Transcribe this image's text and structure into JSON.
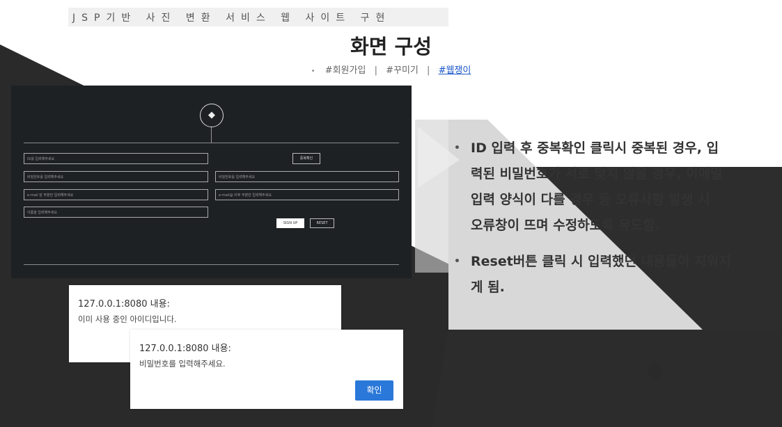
{
  "header": {
    "section_title": "JSP기반 사진 변환 서비스 웹 사이트 구현",
    "slide_title": "화면 구성",
    "tags": [
      "#회원가입",
      "#꾸미기",
      "#웹쟁이"
    ],
    "active_tag": "#웹쟁이"
  },
  "signup_form": {
    "fields": {
      "id": "ID를 입력해주세요",
      "password": "비밀번호를 입력해주세요",
      "password_confirm": "비밀번호를 입력해주세요",
      "email_local": "e-mail 앞 부분만 입력해주세요",
      "email_domain": "e-mail@ 이후 부분만 입력해주세요.",
      "name": "이름을 입력해주세요"
    },
    "buttons": {
      "check_duplicate": "중복확인",
      "sign_up": "SIGN UP",
      "reset": "RESET"
    }
  },
  "dialogs": [
    {
      "title": "127.0.0.1:8080 내용:",
      "message": "이미 사용 중인 아이디입니다."
    },
    {
      "title": "127.0.0.1:8080 내용:",
      "message": "비밀번호를 입력해주세요.",
      "confirm_label": "확인"
    }
  ],
  "bullets": [
    {
      "lines": [
        "ID 입력 후 중복확인 클릭시 중복된 경우, 입",
        "력된 비밀번호가 서로 맞지 않을 경우, 이메일",
        "입력 양식이 다를 경우 등 오류사항 발생 시",
        "오류창이 뜨며 수정하도록 유도함."
      ]
    },
    {
      "lines": [
        "Reset버튼 클릭 시 입력했던 내용들이 지워지",
        "게 됨."
      ]
    }
  ],
  "colors": {
    "accent_blue": "#2a78d9",
    "link_blue": "#1a57c9",
    "dark_bg": "#2b2b2b",
    "panel_bg": "#1e2124"
  }
}
